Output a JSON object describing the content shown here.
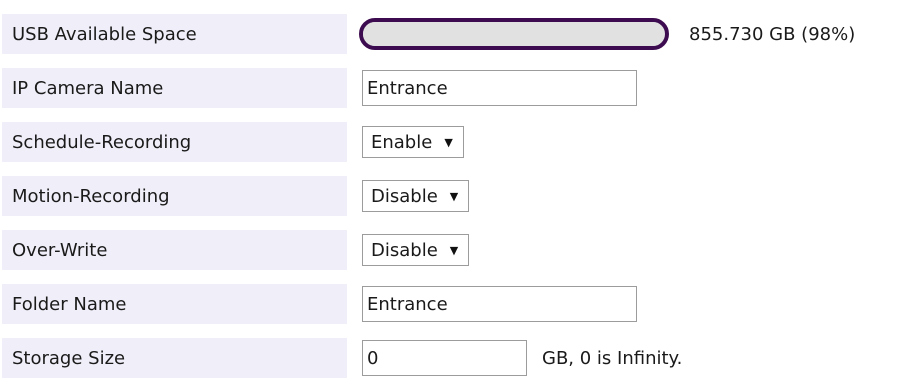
{
  "rows": {
    "usb": {
      "label": "USB Available Space",
      "value_text": "855.730 GB (98%)",
      "available_fraction": 0.98,
      "bar_border_color": "#3d0b4f",
      "bar_fill_color": "#e1e1e1"
    },
    "camera_name": {
      "label": "IP Camera Name",
      "value": "Entrance"
    },
    "schedule": {
      "label": "Schedule-Recording",
      "selected": "Enable"
    },
    "motion": {
      "label": "Motion-Recording",
      "selected": "Disable"
    },
    "overwrite": {
      "label": "Over-Write",
      "selected": "Disable"
    },
    "folder": {
      "label": "Folder Name",
      "value": "Entrance"
    },
    "storage": {
      "label": "Storage Size",
      "value": "0",
      "suffix": "GB, 0 is Infinity."
    }
  },
  "colors": {
    "label_background": "#f0eef8"
  }
}
